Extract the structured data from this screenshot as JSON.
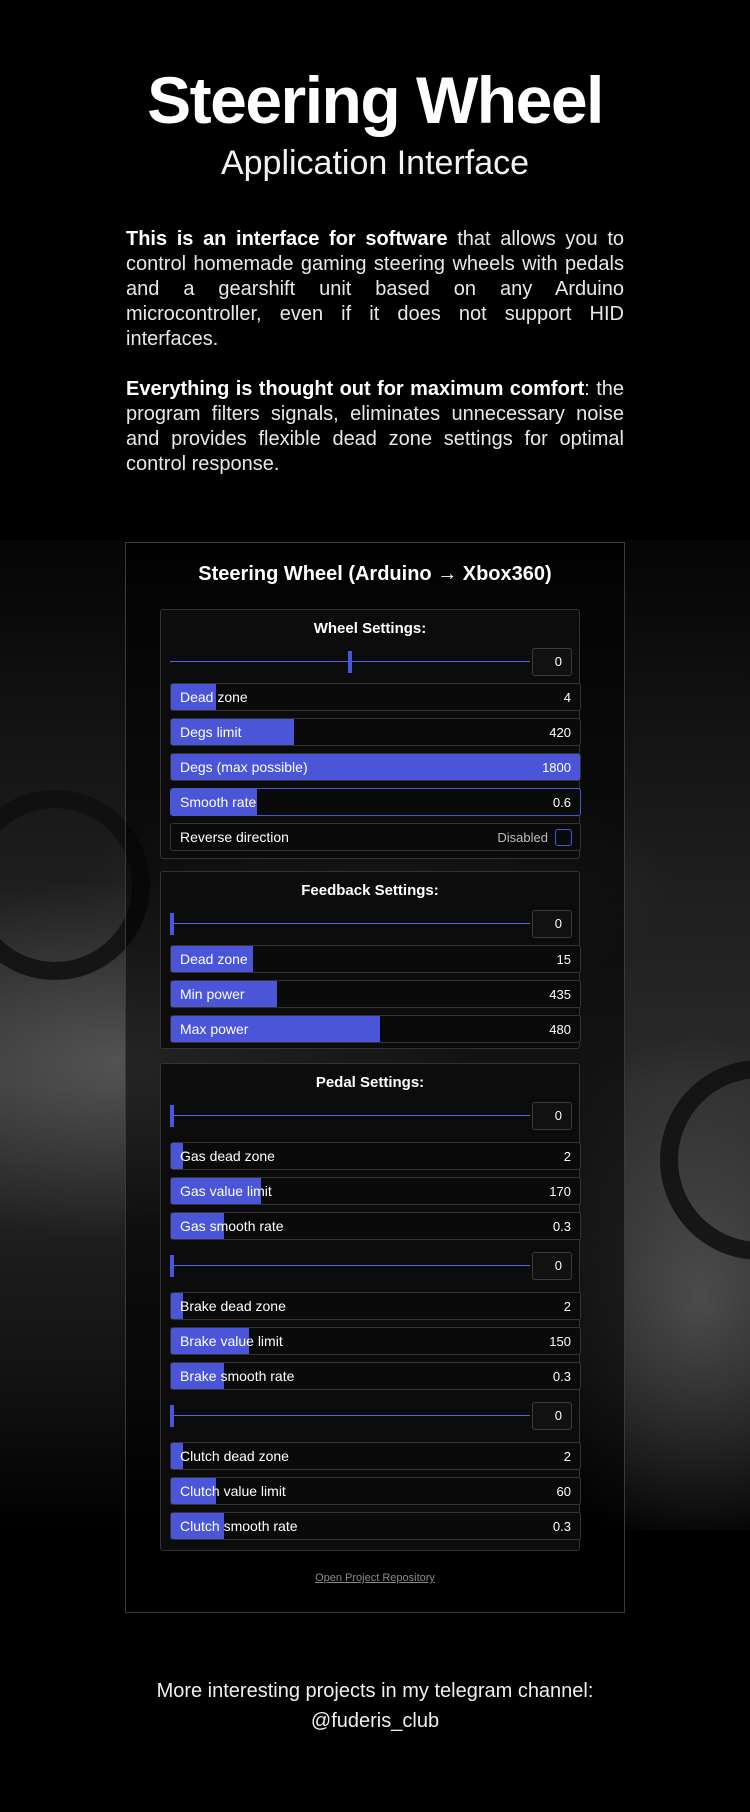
{
  "hero": {
    "title": "Steering Wheel",
    "subtitle": "Application Interface"
  },
  "intro": {
    "p1_bold": "This is an interface for software",
    "p1_rest": " that allows you to control homemade gaming steering wheels with pedals and a gearshift unit based on any Arduino microcontroller, even if it does not support HID interfaces.",
    "p2_bold": "Everything is thought out for maximum comfort",
    "p2_rest": ": the program filters signals, eliminates unnecessary noise and provides flexible dead zone settings for optimal control response."
  },
  "app": {
    "title": "Steering Wheel (Arduino → Xbox360)",
    "repo_link": "Open Project Repository",
    "wheel": {
      "title": "Wheel Settings:",
      "slider": {
        "value": "0",
        "position": 0.5
      },
      "bars": [
        {
          "label": "Dead zone",
          "value": "4",
          "fill": 0.11
        },
        {
          "label": "Degs limit",
          "value": "420",
          "fill": 0.3
        },
        {
          "label": "Degs (max possible)",
          "value": "1800",
          "fill": 1.0
        },
        {
          "label": "Smooth rate",
          "value": "0.6",
          "fill": 0.21
        }
      ],
      "reverse": {
        "label": "Reverse direction",
        "status": "Disabled",
        "checked": false
      }
    },
    "feedback": {
      "title": "Feedback Settings:",
      "slider": {
        "value": "0",
        "position": 0.0
      },
      "bars": [
        {
          "label": "Dead zone",
          "value": "15",
          "fill": 0.2
        },
        {
          "label": "Min power",
          "value": "435",
          "fill": 0.26
        },
        {
          "label": "Max power",
          "value": "480",
          "fill": 0.51
        }
      ]
    },
    "pedals": {
      "title": "Pedal Settings:",
      "gas_slider": {
        "value": "0",
        "position": 0.0
      },
      "gas": [
        {
          "label": "Gas dead zone",
          "value": "2",
          "fill": 0.03
        },
        {
          "label": "Gas value limit",
          "value": "170",
          "fill": 0.22
        },
        {
          "label": "Gas smooth rate",
          "value": "0.3",
          "fill": 0.13
        }
      ],
      "brake_slider": {
        "value": "0",
        "position": 0.0
      },
      "brake": [
        {
          "label": "Brake dead zone",
          "value": "2",
          "fill": 0.03
        },
        {
          "label": "Brake value limit",
          "value": "150",
          "fill": 0.19
        },
        {
          "label": "Brake smooth rate",
          "value": "0.3",
          "fill": 0.13
        }
      ],
      "clutch_slider": {
        "value": "0",
        "position": 0.0
      },
      "clutch": [
        {
          "label": "Clutch dead zone",
          "value": "2",
          "fill": 0.03
        },
        {
          "label": "Clutch value limit",
          "value": "60",
          "fill": 0.11
        },
        {
          "label": "Clutch smooth rate",
          "value": "0.3",
          "fill": 0.13
        }
      ]
    }
  },
  "footer": {
    "line1": "More interesting projects in my telegram channel:",
    "line2": "@fuderis_club"
  },
  "colors": {
    "accent": "#4a55d8",
    "background": "#000000",
    "panel": "#0c0c0c"
  }
}
